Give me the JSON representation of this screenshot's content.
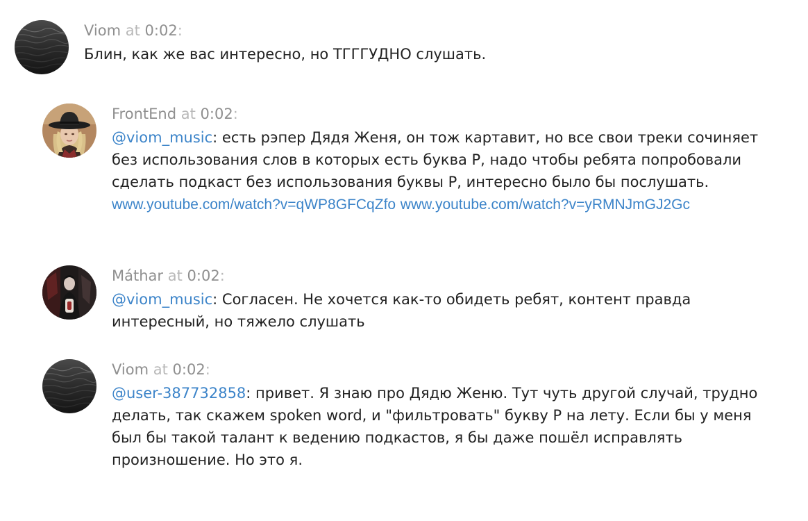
{
  "comments": [
    {
      "author": "Viom",
      "at_word": "at",
      "time": "0:02",
      "colon": ":",
      "avatar_icon": "dark-water-avatar",
      "text": "Блин, как же вас интересно, но ТГГГУДНО слушать."
    },
    {
      "author": "FrontEnd",
      "at_word": "at",
      "time": "0:02",
      "colon": ":",
      "avatar_icon": "woman-in-hat-avatar",
      "mention": "@viom_music",
      "text": ": есть рэпер Дядя Женя, он тож картавит, но все свои треки сочиняет без использования слов в которых есть буква Р, надо чтобы ребята попробовали сделать подкаст без использования буквы Р, интересно было бы послушать. ",
      "link1": "www.youtube.com/watch?v=qWP8GFCqZfo",
      "space": " ",
      "link2": "www.youtube.com/watch?v=yRMNJmGJ2Gc"
    },
    {
      "author": "Máthar",
      "at_word": "at",
      "time": "0:02",
      "colon": ":",
      "avatar_icon": "dark-figure-avatar",
      "mention": "@viom_music",
      "text": ": Согласен. Не хочется как-то обидеть ребят, контент правда интересный, но тяжело слушать"
    },
    {
      "author": "Viom",
      "at_word": "at",
      "time": "0:02",
      "colon": ":",
      "avatar_icon": "dark-water-avatar",
      "mention": "@user-387732858",
      "text": ": привет. Я знаю про Дядю Женю. Тут чуть другой случай, трудно делать, так скажем spoken word, и \"фильтровать\" букву Р на лету. Если бы у меня был бы такой талант к ведению подкастов, я бы даже пошёл исправлять произношение. Но это я."
    }
  ]
}
